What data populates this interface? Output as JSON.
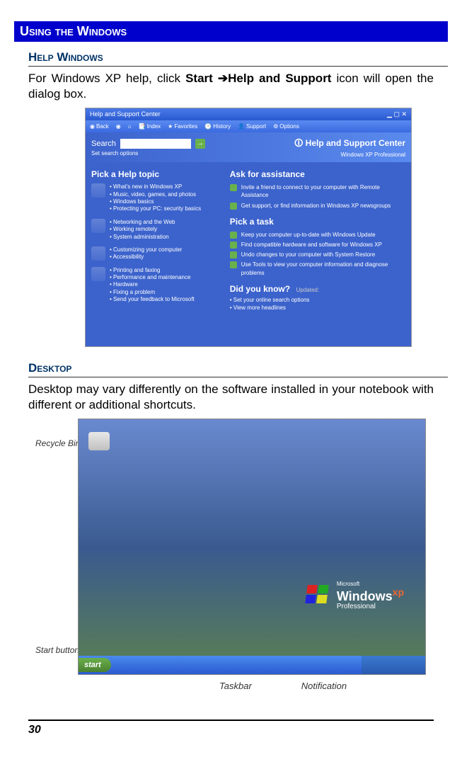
{
  "section_title": "Using the Windows",
  "help_windows": {
    "heading": "Help Windows",
    "paragraph_parts": {
      "p1": "For Windows XP help, click ",
      "bold1": "Start ",
      "arrow": "➔",
      "bold2": "Help and Support",
      "p2": " icon will open the dialog box."
    }
  },
  "help_center": {
    "titlebar": "Help and Support Center",
    "toolbar": {
      "back": "Back",
      "forward": "",
      "index": "Index",
      "favorites": "Favorites",
      "history": "History",
      "support": "Support",
      "options": "Options"
    },
    "search_label": "Search",
    "set_search_options": "Set search options",
    "brand": "Help and Support Center",
    "edition": "Windows XP Professional",
    "left_title": "Pick a Help topic",
    "left_groups": [
      [
        "What's new in Windows XP",
        "Music, video, games, and photos",
        "Windows basics",
        "Protecting your PC: security basics"
      ],
      [
        "Networking and the Web",
        "Working remotely",
        "System administration"
      ],
      [
        "Customizing your computer",
        "Accessibility"
      ],
      [
        "Printing and faxing",
        "Performance and maintenance",
        "Hardware",
        "Fixing a problem",
        "Send your feedback to Microsoft"
      ]
    ],
    "right": {
      "ask_title": "Ask for assistance",
      "ask_items": [
        "Invite a friend to connect to your computer with Remote Assistance",
        "Get support, or find information in Windows XP newsgroups"
      ],
      "task_title": "Pick a task",
      "task_items": [
        "Keep your computer up-to-date with Windows Update",
        "Find compatible hardware and software for Windows XP",
        "Undo changes to your computer with System Restore",
        "Use Tools to view your computer information and diagnose problems"
      ],
      "dyk_title": "Did you know?",
      "dyk_updated": "Updated:",
      "dyk_items": [
        "Set your online search options",
        "View more headlines"
      ]
    }
  },
  "desktop": {
    "heading": "Desktop",
    "paragraph": "Desktop may vary differently on the software installed in your notebook with different or additional shortcuts.",
    "labels": {
      "recycle_bin": "Recycle Bin",
      "start_button": "Start button",
      "taskbar": "Taskbar",
      "notification": "Notification"
    },
    "winlogo": {
      "brand_prefix": "Microsoft",
      "brand": "Windows",
      "xp": "xp",
      "edition": "Professional"
    },
    "start_label": "start"
  },
  "page_number": "30"
}
